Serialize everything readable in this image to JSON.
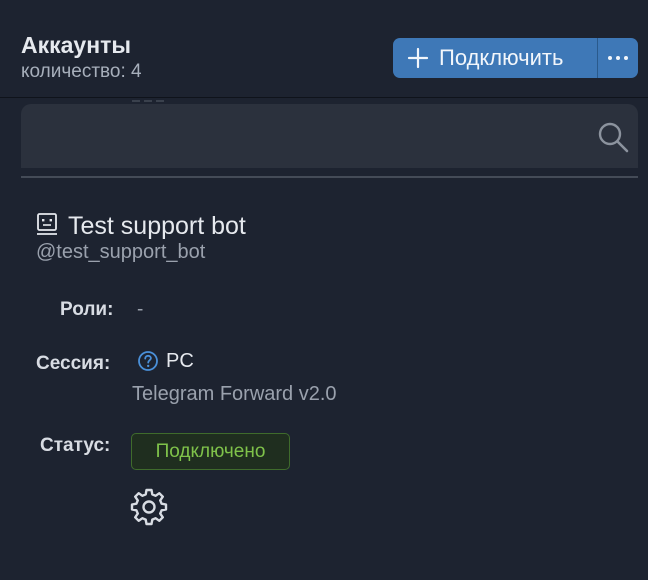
{
  "header": {
    "title": "Аккаунты",
    "count_label": "количество: 4"
  },
  "toolbar": {
    "connect_label": "Подключить",
    "connect_icon": "plus-icon",
    "more_icon": "more-horizontal-icon"
  },
  "search": {
    "value": "",
    "placeholder": "",
    "icon": "search-icon"
  },
  "account": {
    "icon": "bot-icon",
    "name": "Test support bot",
    "handle": "@test_support_bot",
    "fields": {
      "roles_label": "Роли:",
      "roles_value": "-",
      "session_label": "Сессия:",
      "session_device": "PC",
      "session_app": "Telegram Forward v2.0",
      "status_label": "Статус:",
      "status_value": "Подключено"
    },
    "settings_icon": "gear-icon"
  },
  "colors": {
    "background": "#1d2330",
    "accent": "#3e78b7",
    "success": "#7fc24a",
    "muted_text": "#9aa1ad"
  }
}
